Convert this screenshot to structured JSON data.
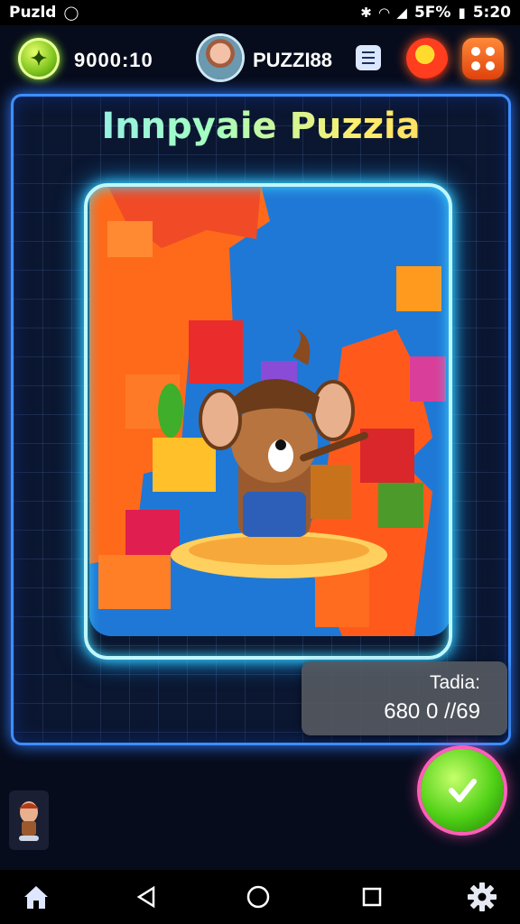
{
  "status_bar": {
    "app_label": "Puzld",
    "time": "5:20",
    "battery": "5F%"
  },
  "top_bar": {
    "coins": "9000:10",
    "player_name": "PUZZI88"
  },
  "board": {
    "title": "Innpyaie Puzzia"
  },
  "score_panel": {
    "label": "Tadia:",
    "value": "680 0 //69"
  },
  "icons": {
    "coin": "lightning-coin-icon",
    "menu": "list-icon",
    "round_button": "shop-icon",
    "square_button": "dice-icon",
    "confirm": "checkmark-icon",
    "home": "home-icon",
    "back": "back-triangle-icon",
    "circle": "home-circle-icon",
    "recents": "recents-square-icon",
    "settings": "gear-icon"
  },
  "colors": {
    "neon_blue": "#3d8fff",
    "neon_cyan": "#bdf7ff",
    "confirm_green": "#4fd016",
    "confirm_ring": "#ff5fb8"
  }
}
